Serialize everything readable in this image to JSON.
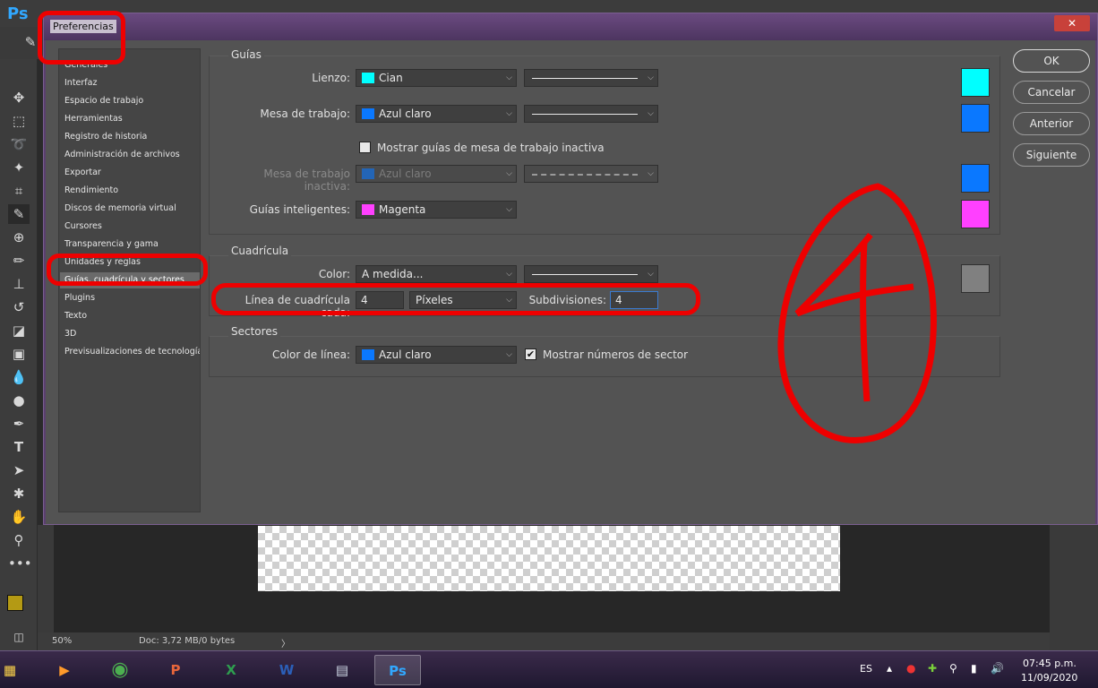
{
  "app": {
    "logo": "Ps"
  },
  "dialog": {
    "title": "Preferencias",
    "close": "✕"
  },
  "sidebar": {
    "items": [
      {
        "label": "Generales"
      },
      {
        "label": "Interfaz"
      },
      {
        "label": "Espacio de trabajo"
      },
      {
        "label": "Herramientas"
      },
      {
        "label": "Registro de historia"
      },
      {
        "label": "Administración de archivos"
      },
      {
        "label": "Exportar"
      },
      {
        "label": "Rendimiento"
      },
      {
        "label": "Discos de memoria virtual"
      },
      {
        "label": "Cursores"
      },
      {
        "label": "Transparencia y gama"
      },
      {
        "label": "Unidades y reglas"
      },
      {
        "label": "Guías, cuadrícula y sectores"
      },
      {
        "label": "Plugins"
      },
      {
        "label": "Texto"
      },
      {
        "label": "3D"
      },
      {
        "label": "Previsualizaciones de tecnología"
      }
    ],
    "active_index": 12
  },
  "guides": {
    "title": "Guías",
    "lienzo": {
      "label": "Lienzo:",
      "value": "Cian",
      "color": "#00ffff"
    },
    "mesa": {
      "label": "Mesa de trabajo:",
      "value": "Azul claro",
      "color": "#0a78ff"
    },
    "show_inactive": {
      "label": "Mostrar guías de mesa de trabajo inactiva",
      "checked": false
    },
    "mesa_inactiva": {
      "label": "Mesa de trabajo inactiva:",
      "value": "Azul claro",
      "color": "#0a78ff"
    },
    "inteligentes": {
      "label": "Guías inteligentes:",
      "value": "Magenta",
      "color": "#ff40ff"
    }
  },
  "grid": {
    "title": "Cuadrícula",
    "color": {
      "label": "Color:",
      "value": "A medida...",
      "color": "#808080"
    },
    "every": {
      "label": "Línea de cuadrícula cada:",
      "value": "4"
    },
    "units": {
      "value": "Píxeles"
    },
    "subdivisions": {
      "label": "Subdivisiones:",
      "value": "4"
    }
  },
  "slices": {
    "title": "Sectores",
    "line_color": {
      "label": "Color de línea:",
      "value": "Azul claro",
      "color": "#0a78ff"
    },
    "show_numbers": {
      "label": "Mostrar números de sector",
      "checked": true
    }
  },
  "buttons": {
    "ok": "OK",
    "cancel": "Cancelar",
    "prev": "Anterior",
    "next": "Siguiente"
  },
  "statusbar": {
    "zoom": "50%",
    "doc": "Doc: 3,72 MB/0 bytes"
  },
  "taskbar": {
    "lang": "ES",
    "time": "07:45 p.m.",
    "date": "11/09/2020"
  },
  "colors": {
    "annotation": "#ee0000"
  }
}
